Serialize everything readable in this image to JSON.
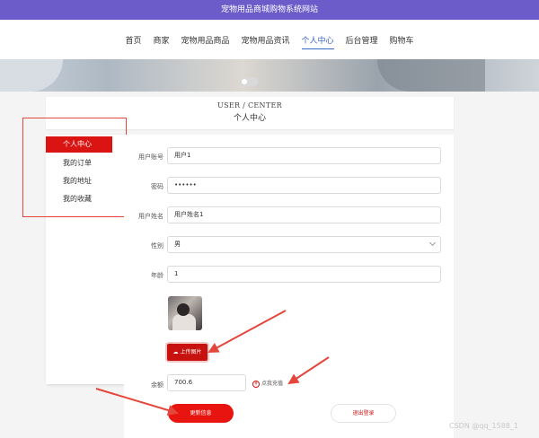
{
  "header": {
    "site_title": "宠物用品商城购物系统网站"
  },
  "nav": {
    "items": [
      {
        "label": "首页",
        "active": false
      },
      {
        "label": "商家",
        "active": false
      },
      {
        "label": "宠物用品商品",
        "active": false
      },
      {
        "label": "宠物用品资讯",
        "active": false
      },
      {
        "label": "个人中心",
        "active": true
      },
      {
        "label": "后台管理",
        "active": false
      },
      {
        "label": "购物车",
        "active": false
      }
    ]
  },
  "user_center": {
    "title_en": "USER / CENTER",
    "title_cn": "个人中心"
  },
  "sidebar": {
    "items": [
      {
        "label": "个人中心",
        "active": true
      },
      {
        "label": "我的订单",
        "active": false
      },
      {
        "label": "我的地址",
        "active": false
      },
      {
        "label": "我的收藏",
        "active": false
      }
    ]
  },
  "form": {
    "account": {
      "label": "用户账号",
      "value": "用户1"
    },
    "password": {
      "label": "密码",
      "value": "••••••"
    },
    "name": {
      "label": "用户姓名",
      "value": "用户姓名1"
    },
    "gender": {
      "label": "性别",
      "value": "男"
    },
    "age": {
      "label": "年龄",
      "value": "1"
    },
    "upload_label": "上传图片",
    "balance": {
      "label": "余额",
      "value": "700.6"
    },
    "recharge_label": "点我充值",
    "recharge_icon": "¥"
  },
  "actions": {
    "update_label": "更新信息",
    "logout_label": "退出登录"
  },
  "watermark": "CSDN @qq_1588_1",
  "colors": {
    "title_bar": "#6b5cc9",
    "nav_active": "#3b67c4",
    "primary_red": "#e81410",
    "annotation_red": "#e5463c"
  }
}
